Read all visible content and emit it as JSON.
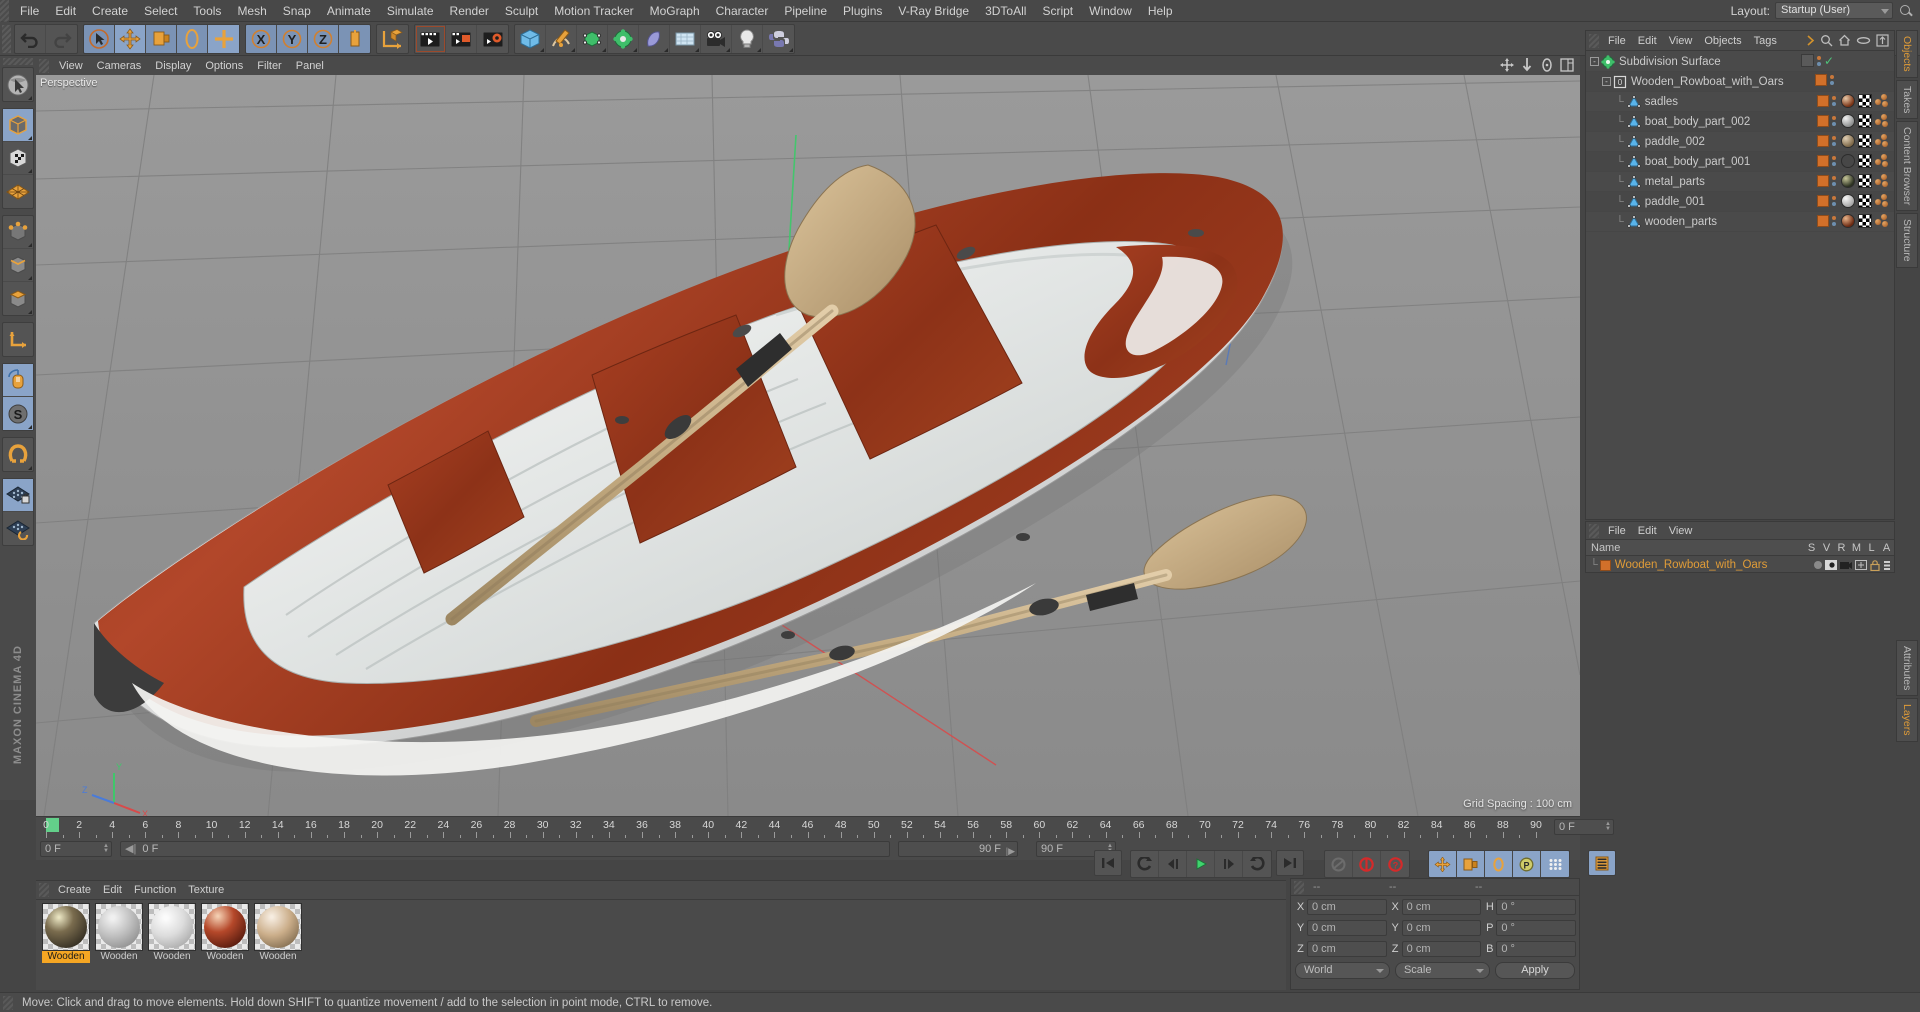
{
  "app": {
    "name": "MAXON CINEMA 4D"
  },
  "menubar": {
    "items": [
      "File",
      "Edit",
      "Create",
      "Select",
      "Tools",
      "Mesh",
      "Snap",
      "Animate",
      "Simulate",
      "Render",
      "Sculpt",
      "Motion Tracker",
      "MoGraph",
      "Character",
      "Pipeline",
      "Plugins",
      "V-Ray Bridge",
      "3DToAll",
      "Script",
      "Window",
      "Help"
    ],
    "layout_label": "Layout:",
    "layout_value": "Startup (User)",
    "search_icon": "search-icon"
  },
  "viewport": {
    "menu": [
      "View",
      "Cameras",
      "Display",
      "Options",
      "Filter",
      "Panel"
    ],
    "camera_label": "Perspective",
    "grid_spacing": "Grid Spacing : 100 cm",
    "nav_icons": [
      "move-camera-icon",
      "dolly-camera-icon",
      "rotate-camera-icon",
      "maximize-view-icon"
    ]
  },
  "object_manager": {
    "menu": [
      "File",
      "Edit",
      "View",
      "Objects",
      "Tags"
    ],
    "menu_overflow": "more-menu-icon",
    "header_icons": [
      "search-icon",
      "home-icon",
      "link-icon",
      "fit-icon"
    ],
    "rows": [
      {
        "name": "Subdivision Surface",
        "depth": 0,
        "icon": "subdivision-surface-icon",
        "expander": "-",
        "has_tags": false,
        "check": true
      },
      {
        "name": "Wooden_Rowboat_with_Oars",
        "depth": 1,
        "icon": "null-object-icon",
        "expander": "-",
        "has_tags": false,
        "check": false
      },
      {
        "name": "sadles",
        "depth": 2,
        "icon": "polygon-object-icon",
        "expander": "",
        "has_tags": true,
        "check": false
      },
      {
        "name": "boat_body_part_002",
        "depth": 2,
        "icon": "polygon-object-icon",
        "expander": "",
        "has_tags": true,
        "check": false
      },
      {
        "name": "paddle_002",
        "depth": 2,
        "icon": "polygon-object-icon",
        "expander": "",
        "has_tags": true,
        "check": false
      },
      {
        "name": "boat_body_part_001",
        "depth": 2,
        "icon": "polygon-object-icon",
        "expander": "",
        "has_tags": true,
        "check": false
      },
      {
        "name": "metal_parts",
        "depth": 2,
        "icon": "polygon-object-icon",
        "expander": "",
        "has_tags": true,
        "check": false
      },
      {
        "name": "paddle_001",
        "depth": 2,
        "icon": "polygon-object-icon",
        "expander": "",
        "has_tags": true,
        "check": false
      },
      {
        "name": "wooden_parts",
        "depth": 2,
        "icon": "polygon-object-icon",
        "expander": "",
        "has_tags": true,
        "check": false
      }
    ],
    "tag_colors": [
      "#5c3b30",
      "#b9b9b9",
      "#9a8a70",
      "#c2c2c2",
      "#4f5542",
      "#cfcfcf",
      "#6e3b28"
    ]
  },
  "layer_manager": {
    "menu": [
      "File",
      "Edit",
      "View"
    ],
    "col_name": "Name",
    "columns": [
      "S",
      "V",
      "R",
      "M",
      "L",
      "A"
    ],
    "rows": [
      {
        "name": "Wooden_Rowboat_with_Oars",
        "color": "#d2702a"
      }
    ]
  },
  "coordinates": {
    "headers": [
      "--",
      "--",
      "--"
    ],
    "position": {
      "label_x": "X",
      "x": "0 cm",
      "label_y": "Y",
      "y": "0 cm",
      "label_z": "Z",
      "z": "0 cm"
    },
    "size": {
      "label_x": "X",
      "x": "0 cm",
      "label_y": "Y",
      "y": "0 cm",
      "label_z": "Z",
      "z": "0 cm"
    },
    "rotation": {
      "label_h": "H",
      "h": "0 °",
      "label_p": "P",
      "p": "0 °",
      "label_b": "B",
      "b": "0 °"
    },
    "system": "World",
    "mode": "Scale",
    "apply": "Apply"
  },
  "timeline": {
    "ticks": [
      0,
      2,
      4,
      6,
      8,
      10,
      12,
      14,
      16,
      18,
      20,
      22,
      24,
      26,
      28,
      30,
      32,
      34,
      36,
      38,
      40,
      42,
      44,
      46,
      48,
      50,
      52,
      54,
      56,
      58,
      60,
      62,
      64,
      66,
      68,
      70,
      72,
      74,
      76,
      78,
      80,
      82,
      84,
      86,
      88,
      90
    ],
    "start": 0,
    "end": 90,
    "current_frame_left": "0 F",
    "current_frame_field": "0 F",
    "range_start": "0 F",
    "range_end": "90 F",
    "preview_end": "90 F",
    "frame_right": "0 F",
    "transport_icons": [
      "go-to-start-icon",
      "play-backward-icon",
      "step-back-icon",
      "play-forward-icon",
      "step-forward-icon",
      "loop-icon",
      "go-to-end-icon",
      "autokey-off-icon",
      "record-key-icon",
      "key-options-icon",
      "position-key-icon",
      "scale-key-icon",
      "rotation-key-icon",
      "param-key-icon",
      "point-key-icon",
      "keyframe-mode-icon"
    ]
  },
  "material_manager": {
    "menu": [
      "Create",
      "Edit",
      "Function",
      "Texture"
    ],
    "materials": [
      {
        "name": "Wooden",
        "selected": true,
        "c1": "#6e6046",
        "c2": "#2a2620"
      },
      {
        "name": "Wooden",
        "selected": false,
        "c1": "#cfcfcf",
        "c2": "#8d8d8d"
      },
      {
        "name": "Wooden",
        "selected": false,
        "c1": "#e4e4e4",
        "c2": "#a8a8a8"
      },
      {
        "name": "Wooden",
        "selected": false,
        "c1": "#c4502a",
        "c2": "#4a150c"
      },
      {
        "name": "Wooden",
        "selected": false,
        "c1": "#d9c1a4",
        "c2": "#7b6348"
      }
    ]
  },
  "side_tabs": {
    "upper": [
      "Objects",
      "Takes",
      "Content Browser",
      "Structure"
    ],
    "upper_active": "Objects",
    "lower": [
      "Attributes",
      "Layers"
    ],
    "lower_active": "Layers"
  },
  "status_bar": {
    "message": "Move: Click and drag to move elements. Hold down SHIFT to quantize movement / add to the selection in point mode, CTRL to remove."
  },
  "left_toolbar": {
    "items": [
      "live-selection-icon",
      "cube-object-mode-icon",
      "texture-mode-icon",
      "polygon-mode-icon",
      "points-mode-icon",
      "edges-mode-icon",
      "polygons-mode-icon",
      "axis-mode-icon",
      "enable-axis-icon",
      "enable-snap-icon",
      "workplane-lock-icon",
      "workplane-icon",
      "quantize-icon"
    ]
  },
  "top_toolbar": {
    "groups": [
      [
        "undo-icon",
        "redo-icon"
      ],
      [
        "select-icon",
        "move-icon",
        "scale-icon",
        "rotate-icon",
        "axis-move-icon"
      ],
      [
        "lock-x-icon",
        "lock-y-icon",
        "lock-z-icon",
        "world-coord-icon"
      ],
      [
        "render-view-icon",
        "render-picture-icon",
        "render-settings-icon"
      ],
      [
        "cube-primitive-icon",
        "spline-pen-icon",
        "array-icon",
        "subdivision-icon",
        "deformer-icon",
        "environment-icon",
        "camera-icon",
        "light-icon",
        "python-icon"
      ]
    ]
  },
  "colors": {
    "accent_orange": "#e09c38",
    "panel_bg": "#4a4a4a",
    "highlight_blue": "#8aa4c8",
    "selection_orange": "#f5a623"
  }
}
